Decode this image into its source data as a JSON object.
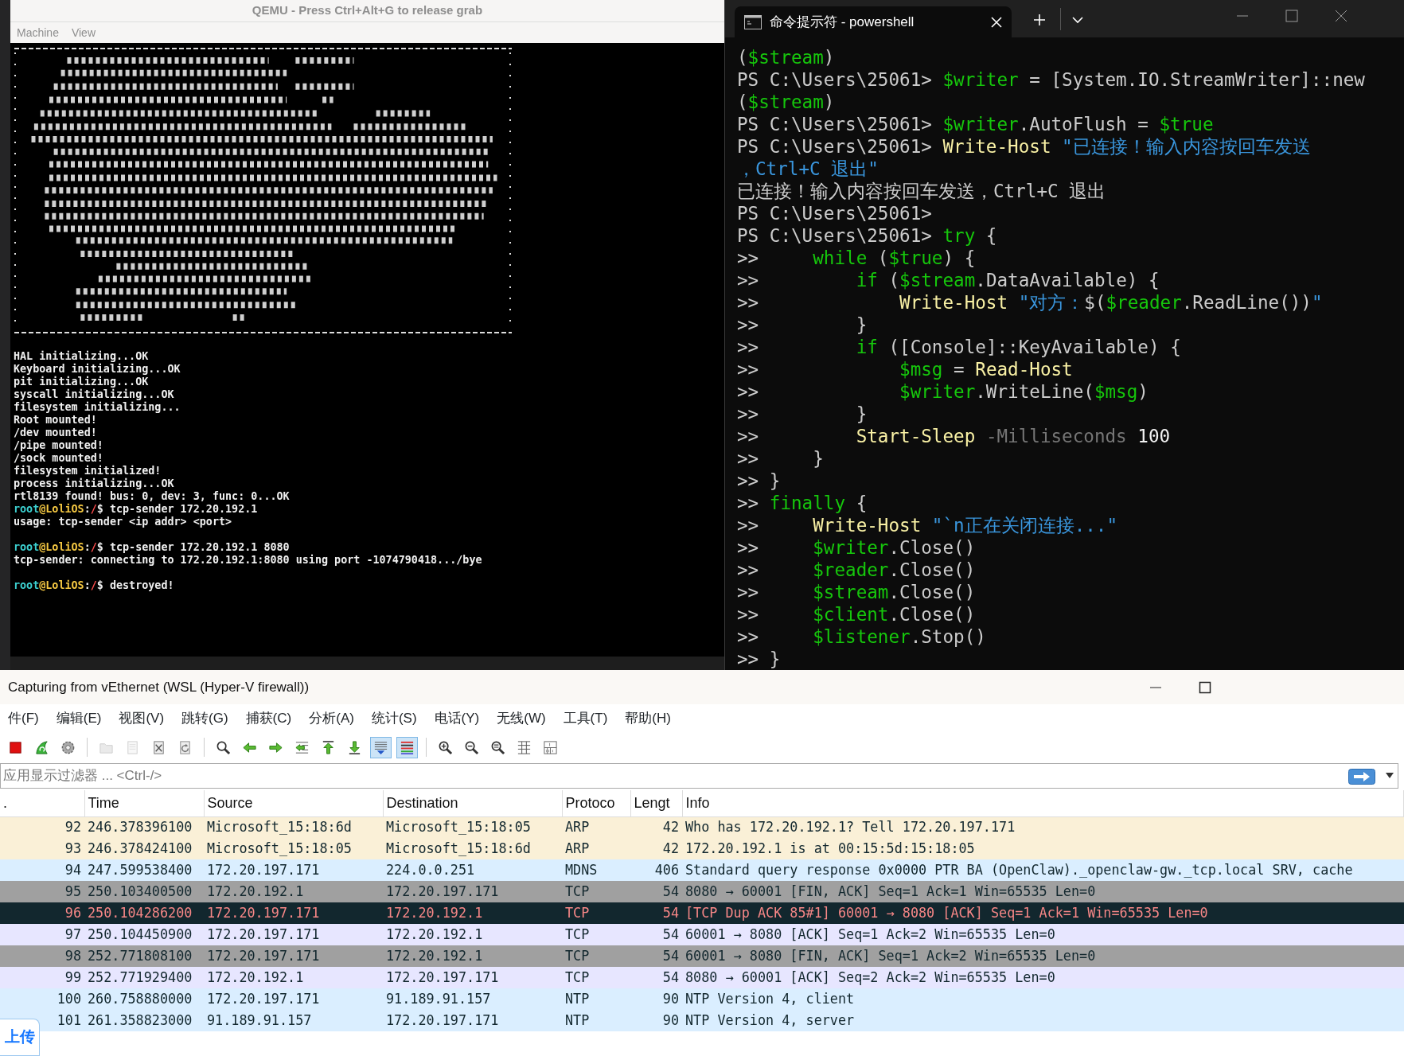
{
  "qemu": {
    "title": "QEMU - Press Ctrl+Alt+G to release grab",
    "menu": [
      "Machine",
      "View"
    ],
    "log": [
      {
        "gap_before": false,
        "segments": [
          {
            "text": "HAL initializing...OK",
            "kind": "plain"
          }
        ]
      },
      {
        "gap_before": false,
        "segments": [
          {
            "text": "Keyboard initializing...OK",
            "kind": "plain"
          }
        ]
      },
      {
        "gap_before": false,
        "segments": [
          {
            "text": "pit initializing...OK",
            "kind": "plain"
          }
        ]
      },
      {
        "gap_before": false,
        "segments": [
          {
            "text": "syscall initializing...OK",
            "kind": "plain"
          }
        ]
      },
      {
        "gap_before": false,
        "segments": [
          {
            "text": "filesystem initializing...",
            "kind": "plain"
          }
        ]
      },
      {
        "gap_before": false,
        "segments": [
          {
            "text": "Root mounted!",
            "kind": "plain"
          }
        ]
      },
      {
        "gap_before": false,
        "segments": [
          {
            "text": "/dev mounted!",
            "kind": "plain"
          }
        ]
      },
      {
        "gap_before": false,
        "segments": [
          {
            "text": "/pipe mounted!",
            "kind": "plain"
          }
        ]
      },
      {
        "gap_before": false,
        "segments": [
          {
            "text": "/sock mounted!",
            "kind": "plain"
          }
        ]
      },
      {
        "gap_before": false,
        "segments": [
          {
            "text": "filesystem initialized!",
            "kind": "plain"
          }
        ]
      },
      {
        "gap_before": false,
        "segments": [
          {
            "text": "process initializing...OK",
            "kind": "plain"
          }
        ]
      },
      {
        "gap_before": false,
        "segments": [
          {
            "text": "rtl8139 found! bus: 0, dev: 3, func: 0...OK",
            "kind": "plain"
          }
        ]
      },
      {
        "gap_before": false,
        "segments": [
          {
            "text": "root",
            "kind": "user"
          },
          {
            "text": "@LoliOS",
            "kind": "host"
          },
          {
            "text": ":",
            "kind": "plain"
          },
          {
            "text": "/",
            "kind": "path"
          },
          {
            "text": "$ tcp-sender 172.20.192.1",
            "kind": "plain"
          }
        ]
      },
      {
        "gap_before": false,
        "segments": [
          {
            "text": "usage: tcp-sender <ip addr> <port>",
            "kind": "plain"
          }
        ]
      },
      {
        "gap_before": true,
        "segments": [
          {
            "text": "root",
            "kind": "user"
          },
          {
            "text": "@LoliOS",
            "kind": "host"
          },
          {
            "text": ":",
            "kind": "plain"
          },
          {
            "text": "/",
            "kind": "path"
          },
          {
            "text": "$ tcp-sender 172.20.192.1 8080",
            "kind": "plain"
          }
        ]
      },
      {
        "gap_before": false,
        "segments": [
          {
            "text": "tcp-sender: connecting to 172.20.192.1:8080 using port -1074790418.../bye",
            "kind": "plain"
          }
        ]
      },
      {
        "gap_before": true,
        "segments": [
          {
            "text": "root",
            "kind": "user"
          },
          {
            "text": "@LoliOS",
            "kind": "host"
          },
          {
            "text": ":",
            "kind": "plain"
          },
          {
            "text": "/",
            "kind": "path"
          },
          {
            "text": "$ destroyed!",
            "kind": "plain"
          }
        ]
      }
    ]
  },
  "terminal": {
    "tab": {
      "title": "命令提示符 - powershell",
      "selected": true
    },
    "lines": [
      {
        "segments": [
          {
            "text": "(",
            "kind": "plain"
          },
          {
            "text": "$stream",
            "kind": "variable"
          },
          {
            "text": ")",
            "kind": "plain"
          }
        ]
      },
      {
        "segments": [
          {
            "text": "PS C:\\Users\\25061> ",
            "kind": "plain"
          },
          {
            "text": "$writer",
            "kind": "variable"
          },
          {
            "text": " = [System.IO.StreamWriter]::new",
            "kind": "plain"
          }
        ]
      },
      {
        "segments": [
          {
            "text": "(",
            "kind": "plain"
          },
          {
            "text": "$stream",
            "kind": "variable"
          },
          {
            "text": ")",
            "kind": "plain"
          }
        ]
      },
      {
        "segments": [
          {
            "text": "PS C:\\Users\\25061> ",
            "kind": "plain"
          },
          {
            "text": "$writer",
            "kind": "variable"
          },
          {
            "text": ".AutoFlush = ",
            "kind": "plain"
          },
          {
            "text": "$true",
            "kind": "variable"
          }
        ]
      },
      {
        "segments": [
          {
            "text": "PS C:\\Users\\25061> ",
            "kind": "plain"
          },
          {
            "text": "Write-Host",
            "kind": "command"
          },
          {
            "text": " \"已连接！输入内容按回车发送",
            "kind": "string"
          }
        ]
      },
      {
        "segments": [
          {
            "text": "，Ctrl+C 退出\"",
            "kind": "string"
          }
        ]
      },
      {
        "segments": [
          {
            "text": "已连接！输入内容按回车发送，Ctrl+C 退出",
            "kind": "plain"
          }
        ]
      },
      {
        "segments": [
          {
            "text": "PS C:\\Users\\25061>",
            "kind": "plain"
          }
        ]
      },
      {
        "segments": [
          {
            "text": "PS C:\\Users\\25061> ",
            "kind": "plain"
          },
          {
            "text": "try",
            "kind": "keyword"
          },
          {
            "text": " {",
            "kind": "plain"
          }
        ]
      },
      {
        "segments": [
          {
            "text": ">>     ",
            "kind": "plain"
          },
          {
            "text": "while",
            "kind": "keyword"
          },
          {
            "text": " (",
            "kind": "plain"
          },
          {
            "text": "$true",
            "kind": "variable"
          },
          {
            "text": ") {",
            "kind": "plain"
          }
        ]
      },
      {
        "segments": [
          {
            "text": ">>         ",
            "kind": "plain"
          },
          {
            "text": "if",
            "kind": "keyword"
          },
          {
            "text": " (",
            "kind": "plain"
          },
          {
            "text": "$stream",
            "kind": "variable"
          },
          {
            "text": ".DataAvailable) {",
            "kind": "plain"
          }
        ]
      },
      {
        "segments": [
          {
            "text": ">>             ",
            "kind": "plain"
          },
          {
            "text": "Write-Host",
            "kind": "command"
          },
          {
            "text": " \"对方：",
            "kind": "string"
          },
          {
            "text": "$(",
            "kind": "plain"
          },
          {
            "text": "$reader",
            "kind": "variable"
          },
          {
            "text": ".ReadLine())",
            "kind": "plain"
          },
          {
            "text": "\"",
            "kind": "string"
          }
        ]
      },
      {
        "segments": [
          {
            "text": ">>         }",
            "kind": "plain"
          }
        ]
      },
      {
        "segments": [
          {
            "text": ">>         ",
            "kind": "plain"
          },
          {
            "text": "if",
            "kind": "keyword"
          },
          {
            "text": " ([Console]::KeyAvailable) {",
            "kind": "plain"
          }
        ]
      },
      {
        "segments": [
          {
            "text": ">>             ",
            "kind": "plain"
          },
          {
            "text": "$msg",
            "kind": "variable"
          },
          {
            "text": " = ",
            "kind": "plain"
          },
          {
            "text": "Read-Host",
            "kind": "command"
          }
        ]
      },
      {
        "segments": [
          {
            "text": ">>             ",
            "kind": "plain"
          },
          {
            "text": "$writer",
            "kind": "variable"
          },
          {
            "text": ".WriteLine(",
            "kind": "plain"
          },
          {
            "text": "$msg",
            "kind": "variable"
          },
          {
            "text": ")",
            "kind": "plain"
          }
        ]
      },
      {
        "segments": [
          {
            "text": ">>         }",
            "kind": "plain"
          }
        ]
      },
      {
        "segments": [
          {
            "text": ">>         ",
            "kind": "plain"
          },
          {
            "text": "Start-Sleep",
            "kind": "command"
          },
          {
            "text": " -Milliseconds",
            "kind": "parameter"
          },
          {
            "text": " 100",
            "kind": "number"
          }
        ]
      },
      {
        "segments": [
          {
            "text": ">>     }",
            "kind": "plain"
          }
        ]
      },
      {
        "segments": [
          {
            "text": ">> }",
            "kind": "plain"
          }
        ]
      },
      {
        "segments": [
          {
            "text": ">> ",
            "kind": "plain"
          },
          {
            "text": "finally",
            "kind": "keyword"
          },
          {
            "text": " {",
            "kind": "plain"
          }
        ]
      },
      {
        "segments": [
          {
            "text": ">>     ",
            "kind": "plain"
          },
          {
            "text": "Write-Host",
            "kind": "command"
          },
          {
            "text": " \"`n正在关闭连接...\"",
            "kind": "string"
          }
        ]
      },
      {
        "segments": [
          {
            "text": ">>     ",
            "kind": "plain"
          },
          {
            "text": "$writer",
            "kind": "variable"
          },
          {
            "text": ".Close()",
            "kind": "plain"
          }
        ]
      },
      {
        "segments": [
          {
            "text": ">>     ",
            "kind": "plain"
          },
          {
            "text": "$reader",
            "kind": "variable"
          },
          {
            "text": ".Close()",
            "kind": "plain"
          }
        ]
      },
      {
        "segments": [
          {
            "text": ">>     ",
            "kind": "plain"
          },
          {
            "text": "$stream",
            "kind": "variable"
          },
          {
            "text": ".Close()",
            "kind": "plain"
          }
        ]
      },
      {
        "segments": [
          {
            "text": ">>     ",
            "kind": "plain"
          },
          {
            "text": "$client",
            "kind": "variable"
          },
          {
            "text": ".Close()",
            "kind": "plain"
          }
        ]
      },
      {
        "segments": [
          {
            "text": ">>     ",
            "kind": "plain"
          },
          {
            "text": "$listener",
            "kind": "variable"
          },
          {
            "text": ".Stop()",
            "kind": "plain"
          }
        ]
      },
      {
        "segments": [
          {
            "text": ">> }",
            "kind": "plain"
          }
        ]
      }
    ]
  },
  "wireshark": {
    "title": "Capturing from vEthernet (WSL (Hyper-V firewall))",
    "menu": [
      "件(F)",
      "编辑(E)",
      "视图(V)",
      "跳转(G)",
      "捕获(C)",
      "分析(A)",
      "统计(S)",
      "电话(Y)",
      "无线(W)",
      "工具(T)",
      "帮助(H)"
    ],
    "toolbar": [
      {
        "kind": "stop",
        "disabled": false,
        "on": false
      },
      {
        "kind": "restart",
        "disabled": false,
        "on": false
      },
      {
        "kind": "options",
        "disabled": false,
        "on": false
      },
      {
        "kind": "open",
        "disabled": true,
        "on": false
      },
      {
        "kind": "save",
        "disabled": true,
        "on": false
      },
      {
        "kind": "close",
        "disabled": false,
        "on": false
      },
      {
        "kind": "reload",
        "disabled": false,
        "on": false
      },
      {
        "kind": "find",
        "disabled": false,
        "on": false
      },
      {
        "kind": "back",
        "disabled": false,
        "on": false
      },
      {
        "kind": "forward",
        "disabled": false,
        "on": false
      },
      {
        "kind": "goto",
        "disabled": false,
        "on": false
      },
      {
        "kind": "first",
        "disabled": false,
        "on": false
      },
      {
        "kind": "last",
        "disabled": false,
        "on": false
      },
      {
        "kind": "autoscroll",
        "disabled": false,
        "on": true
      },
      {
        "kind": "colorize",
        "disabled": false,
        "on": true
      },
      {
        "kind": "zoomin",
        "disabled": false,
        "on": false
      },
      {
        "kind": "zoomout",
        "disabled": false,
        "on": false
      },
      {
        "kind": "zoomreset",
        "disabled": false,
        "on": false
      },
      {
        "kind": "resize",
        "disabled": false,
        "on": false
      },
      {
        "kind": "layout",
        "disabled": false,
        "on": false
      }
    ],
    "filter": {
      "placeholder": "应用显示过滤器 ... <Ctrl-/>"
    },
    "packet_list": {
      "columns": [
        ".",
        "Time",
        "Source",
        "Destination",
        "Protoco",
        "Lengt",
        "Info"
      ],
      "rows": [
        {
          "no": "92",
          "time": "246.378396100",
          "source": "Microsoft_15:18:6d",
          "destination": "Microsoft_15:18:05",
          "protocol": "ARP",
          "length": "42",
          "info": "Who has 172.20.192.1? Tell 172.20.197.171",
          "color": "#faf0d7",
          "kind": "normal"
        },
        {
          "no": "93",
          "time": "246.378424100",
          "source": "Microsoft_15:18:05",
          "destination": "Microsoft_15:18:6d",
          "protocol": "ARP",
          "length": "42",
          "info": "172.20.192.1 is at 00:15:5d:15:18:05",
          "color": "#faf0d7",
          "kind": "normal"
        },
        {
          "no": "94",
          "time": "247.599538400",
          "source": "172.20.197.171",
          "destination": "224.0.0.251",
          "protocol": "MDNS",
          "length": "406",
          "info": "Standard query response 0x0000 PTR BA (OpenClaw)._openclaw-gw._tcp.local SRV, cache",
          "color": "#daeeff",
          "kind": "normal"
        },
        {
          "no": "95",
          "time": "250.103400500",
          "source": "172.20.192.1",
          "destination": "172.20.197.171",
          "protocol": "TCP",
          "length": "54",
          "info": "8080 → 60001 [FIN, ACK] Seq=1 Ack=1 Win=65535 Len=0",
          "color": "#a0a0a0",
          "kind": "normal"
        },
        {
          "no": "96",
          "time": "250.104286200",
          "source": "172.20.197.171",
          "destination": "172.20.192.1",
          "protocol": "TCP",
          "length": "54",
          "info": "[TCP Dup ACK 85#1] 60001 → 8080 [ACK] Seq=1 Ack=1 Win=65535 Len=0",
          "color": "#12272e",
          "kind": "alert"
        },
        {
          "no": "97",
          "time": "250.104450900",
          "source": "172.20.197.171",
          "destination": "172.20.192.1",
          "protocol": "TCP",
          "length": "54",
          "info": "60001 → 8080 [ACK] Seq=1 Ack=2 Win=65535 Len=0",
          "color": "#e7e6ff",
          "kind": "normal"
        },
        {
          "no": "98",
          "time": "252.771808100",
          "source": "172.20.197.171",
          "destination": "172.20.192.1",
          "protocol": "TCP",
          "length": "54",
          "info": "60001 → 8080 [FIN, ACK] Seq=1 Ack=2 Win=65535 Len=0",
          "color": "#a0a0a0",
          "kind": "normal"
        },
        {
          "no": "99",
          "time": "252.771929400",
          "source": "172.20.192.1",
          "destination": "172.20.197.171",
          "protocol": "TCP",
          "length": "54",
          "info": "8080 → 60001 [ACK] Seq=2 Ack=2 Win=65535 Len=0",
          "color": "#e7e6ff",
          "kind": "normal"
        },
        {
          "no": "100",
          "time": "260.758880000",
          "source": "172.20.197.171",
          "destination": "91.189.91.157",
          "protocol": "NTP",
          "length": "90",
          "info": "NTP Version 4, client",
          "color": "#daeeff",
          "kind": "normal"
        },
        {
          "no": "101",
          "time": "261.358823000",
          "source": "91.189.91.157",
          "destination": "172.20.197.171",
          "protocol": "NTP",
          "length": "90",
          "info": "NTP Version 4, server",
          "color": "#daeeff",
          "kind": "normal"
        }
      ]
    },
    "upload_button": "上传"
  }
}
